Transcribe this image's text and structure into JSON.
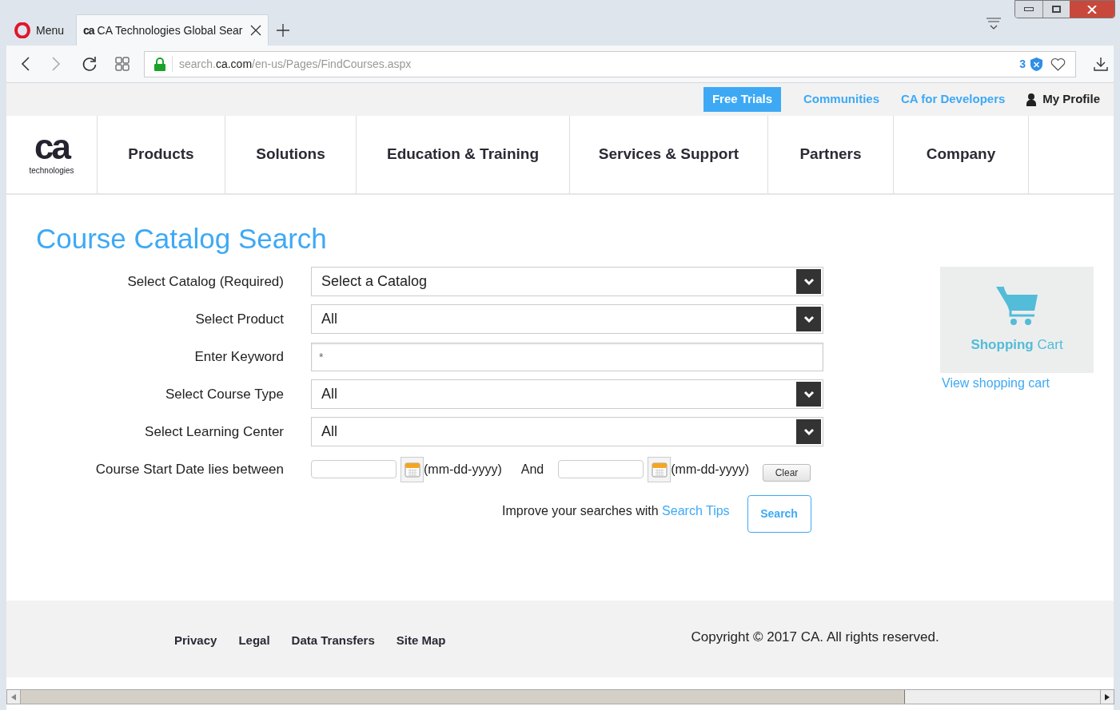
{
  "browser": {
    "menu": "Menu",
    "tabs": [
      {
        "favicon": "ca",
        "title": "CA Technologies Global Sear",
        "selected": true
      }
    ],
    "address": {
      "prefix": "search.",
      "domain": "ca.com",
      "path": "/en-us/Pages/FindCourses.aspx"
    },
    "blocked_count": "3"
  },
  "utility_bar": [
    {
      "kind": "button",
      "label": "Free Trials"
    },
    {
      "kind": "link",
      "label": "Communities"
    },
    {
      "kind": "link",
      "label": "CA for Developers"
    },
    {
      "kind": "profile",
      "label": "My Profile"
    }
  ],
  "logo": {
    "mark": "ca",
    "subtitle": "technologies"
  },
  "nav": [
    "Products",
    "Solutions",
    "Education & Training",
    "Services & Support",
    "Partners",
    "Company"
  ],
  "title": "Course Catalog Search",
  "form": [
    {
      "kind": "select",
      "label": "Select Catalog (Required)",
      "value": "Select a Catalog"
    },
    {
      "kind": "select",
      "label": "Select Product",
      "value": "All"
    },
    {
      "kind": "text",
      "label": "Enter Keyword",
      "value": "*"
    },
    {
      "kind": "select",
      "label": "Select Course Type",
      "value": "All"
    },
    {
      "kind": "select",
      "label": "Select Learning Center",
      "value": "All"
    },
    {
      "kind": "daterange",
      "label": "Course Start Date lies between",
      "from_hint": "(mm-dd-yyyy)",
      "joiner": "And",
      "to_hint": "(mm-dd-yyyy)",
      "clear": "Clear"
    }
  ],
  "tips": {
    "text": "Improve your searches with",
    "link": "Search Tips"
  },
  "search_button": "Search",
  "cart": {
    "image_text": "**Shopping** Cart",
    "link": "View shopping cart"
  },
  "footer": {
    "links": [
      "Privacy",
      "Legal",
      "Data Transfers",
      "Site Map"
    ],
    "copyright": "Copyright © 2017 CA. All rights reserved."
  }
}
